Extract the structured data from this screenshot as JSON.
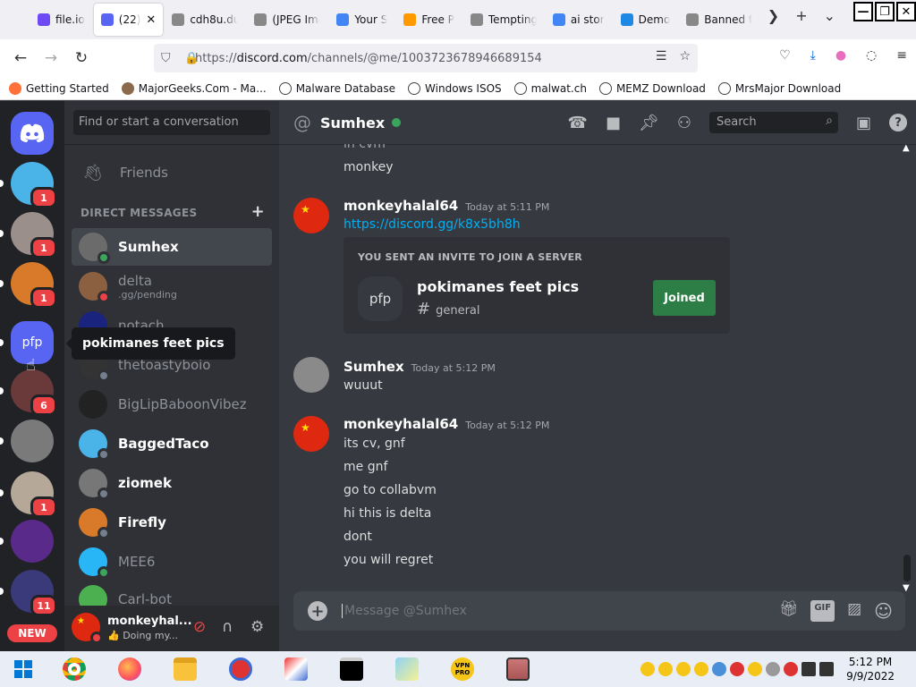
{
  "browser": {
    "tabs": [
      {
        "title": "file.io",
        "icon_color": "#6e4af5"
      },
      {
        "title": "(22)",
        "icon_color": "#5865f2",
        "active": true
      },
      {
        "title": "cdh8u.du",
        "icon_color": "#888888"
      },
      {
        "title": "(JPEG Ima",
        "icon_color": "#888888"
      },
      {
        "title": "Your S",
        "icon_color": "#4285f4"
      },
      {
        "title": "Free P",
        "icon_color": "#ff9900"
      },
      {
        "title": "Tempting",
        "icon_color": "#888888"
      },
      {
        "title": "ai stor",
        "icon_color": "#4285f4"
      },
      {
        "title": "Demo",
        "icon_color": "#1e88e5"
      },
      {
        "title": "Banned fo",
        "icon_color": "#888888"
      }
    ],
    "url_prefix": "https://",
    "url_domain": "discord.com",
    "url_path": "/channels/@me/1003723678946689154",
    "bookmarks": [
      "Getting Started",
      "MajorGeeks.Com - Ma...",
      "Malware Database",
      "Windows ISOS",
      "malwat.ch",
      "MEMZ Download",
      "MrsMajor Download"
    ]
  },
  "servers": [
    {
      "badge": "1",
      "color": "#4ab3e8"
    },
    {
      "badge": "1",
      "color": "#9a8f8a"
    },
    {
      "badge": "1",
      "color": "#d97a2a"
    },
    {
      "label": "pfp",
      "color": "#5865f2"
    },
    {
      "badge": "6",
      "color": "#6a3a3a"
    },
    {
      "badge": "",
      "color": "#7a7a7a"
    },
    {
      "badge": "1",
      "color": "#b5a898"
    },
    {
      "badge": "",
      "color": "#5a2a8a"
    },
    {
      "badge": "11",
      "color": "#3a3a7a"
    }
  ],
  "servers_new_label": "NEW",
  "dm_sidebar": {
    "search_placeholder": "Find or start a conversation",
    "friends_label": "Friends",
    "header": "DIRECT MESSAGES",
    "dms": [
      {
        "name": "Sumhex",
        "status": "online",
        "color": "#6b6b6b"
      },
      {
        "name": "delta",
        "sub": ".gg/pending",
        "status": "dnd",
        "color": "#8a6040"
      },
      {
        "name": "notach",
        "status": "",
        "color": "#1a237e"
      },
      {
        "name": "thetoastyboio",
        "status": "offline",
        "color": "#333333"
      },
      {
        "name": "BigLipBaboonVibez",
        "status": "",
        "color": "#222222"
      },
      {
        "name": "BaggedTaco",
        "status": "offline",
        "color": "#4ab3e8"
      },
      {
        "name": "ziomek",
        "status": "offline",
        "color": "#777777"
      },
      {
        "name": "Firefly",
        "status": "offline",
        "color": "#d97a2a"
      },
      {
        "name": "MEE6",
        "status": "online",
        "color": "#29b6f6"
      },
      {
        "name": "Carl-bot",
        "status": "",
        "color": "#4caf50"
      }
    ],
    "tooltip": "pokimanes feet pics"
  },
  "user_panel": {
    "name": "monkeyhal...",
    "status": "👍 Doing my..."
  },
  "chat": {
    "channel_name": "Sumhex",
    "search_placeholder": "Search",
    "partial_line": "in cvm",
    "messages": [
      {
        "author": "",
        "lines": [
          "monkey"
        ]
      },
      {
        "author": "monkeyhalal64",
        "time": "Today at 5:11 PM",
        "link": "https://discord.gg/k8x5bh8h"
      },
      {
        "author": "Sumhex",
        "time": "Today at 5:12 PM",
        "lines": [
          "wuuut"
        ]
      },
      {
        "author": "monkeyhalal64",
        "time": "Today at 5:12 PM",
        "lines": [
          "its cv, gnf",
          "me gnf",
          "go to collabvm",
          "hi this is delta",
          "dont",
          "you will regret"
        ]
      }
    ],
    "invite": {
      "header": "YOU SENT AN INVITE TO JOIN A SERVER",
      "icon_text": "pfp",
      "server_name": "pokimanes feet pics",
      "channel": "general",
      "button": "Joined"
    },
    "composer_placeholder": "Message @Sumhex"
  },
  "taskbar": {
    "time": "5:12 PM",
    "date": "9/9/2022"
  }
}
